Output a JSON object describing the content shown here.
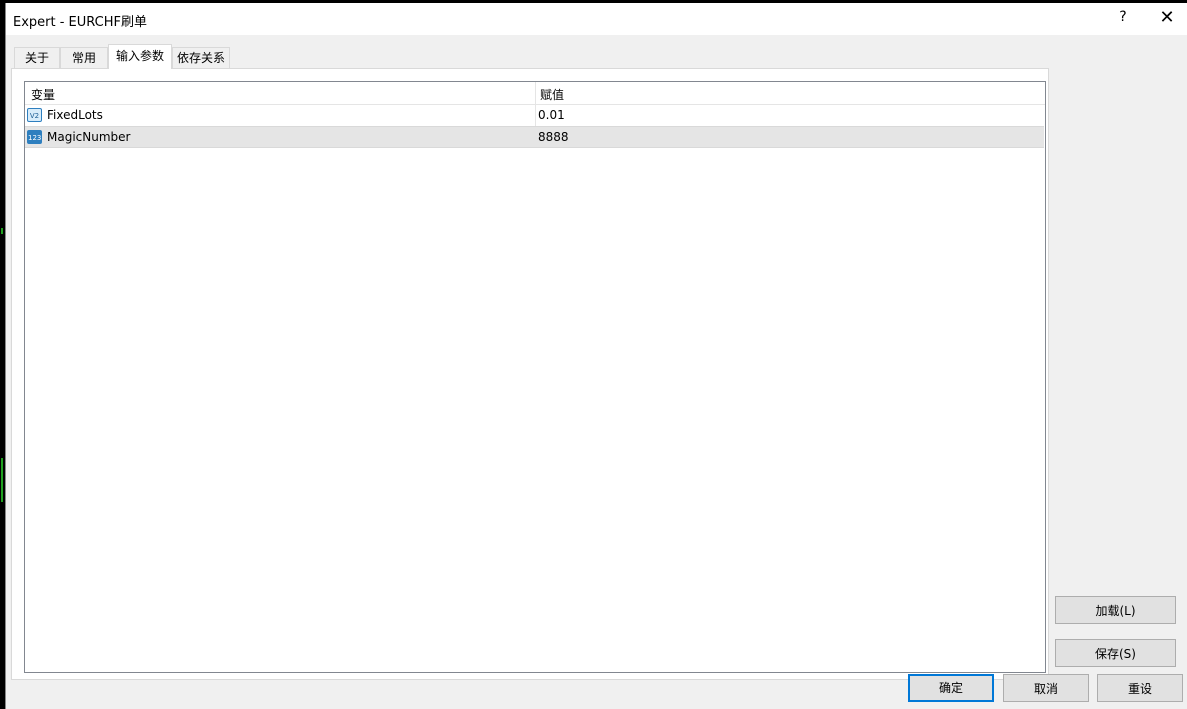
{
  "window": {
    "title": "Expert - EURCHF刷单",
    "help_label": "?",
    "close_label": "✕"
  },
  "tabs": [
    {
      "label": "关于",
      "active": false
    },
    {
      "label": "常用",
      "active": false
    },
    {
      "label": "输入参数",
      "active": true
    },
    {
      "label": "依存关系",
      "active": false
    }
  ],
  "table": {
    "columns": [
      "变量",
      "赋值"
    ],
    "rows": [
      {
        "icon": "decimal-value-icon",
        "icon_text": "V2",
        "name": "FixedLots",
        "value": "0.01"
      },
      {
        "icon": "integer-value-icon",
        "icon_text": "123",
        "name": "MagicNumber",
        "value": "8888"
      }
    ]
  },
  "side_buttons": {
    "load": "加载(L)",
    "save": "保存(S)"
  },
  "footer_buttons": {
    "ok": "确定",
    "cancel": "取消",
    "reset": "重设"
  }
}
